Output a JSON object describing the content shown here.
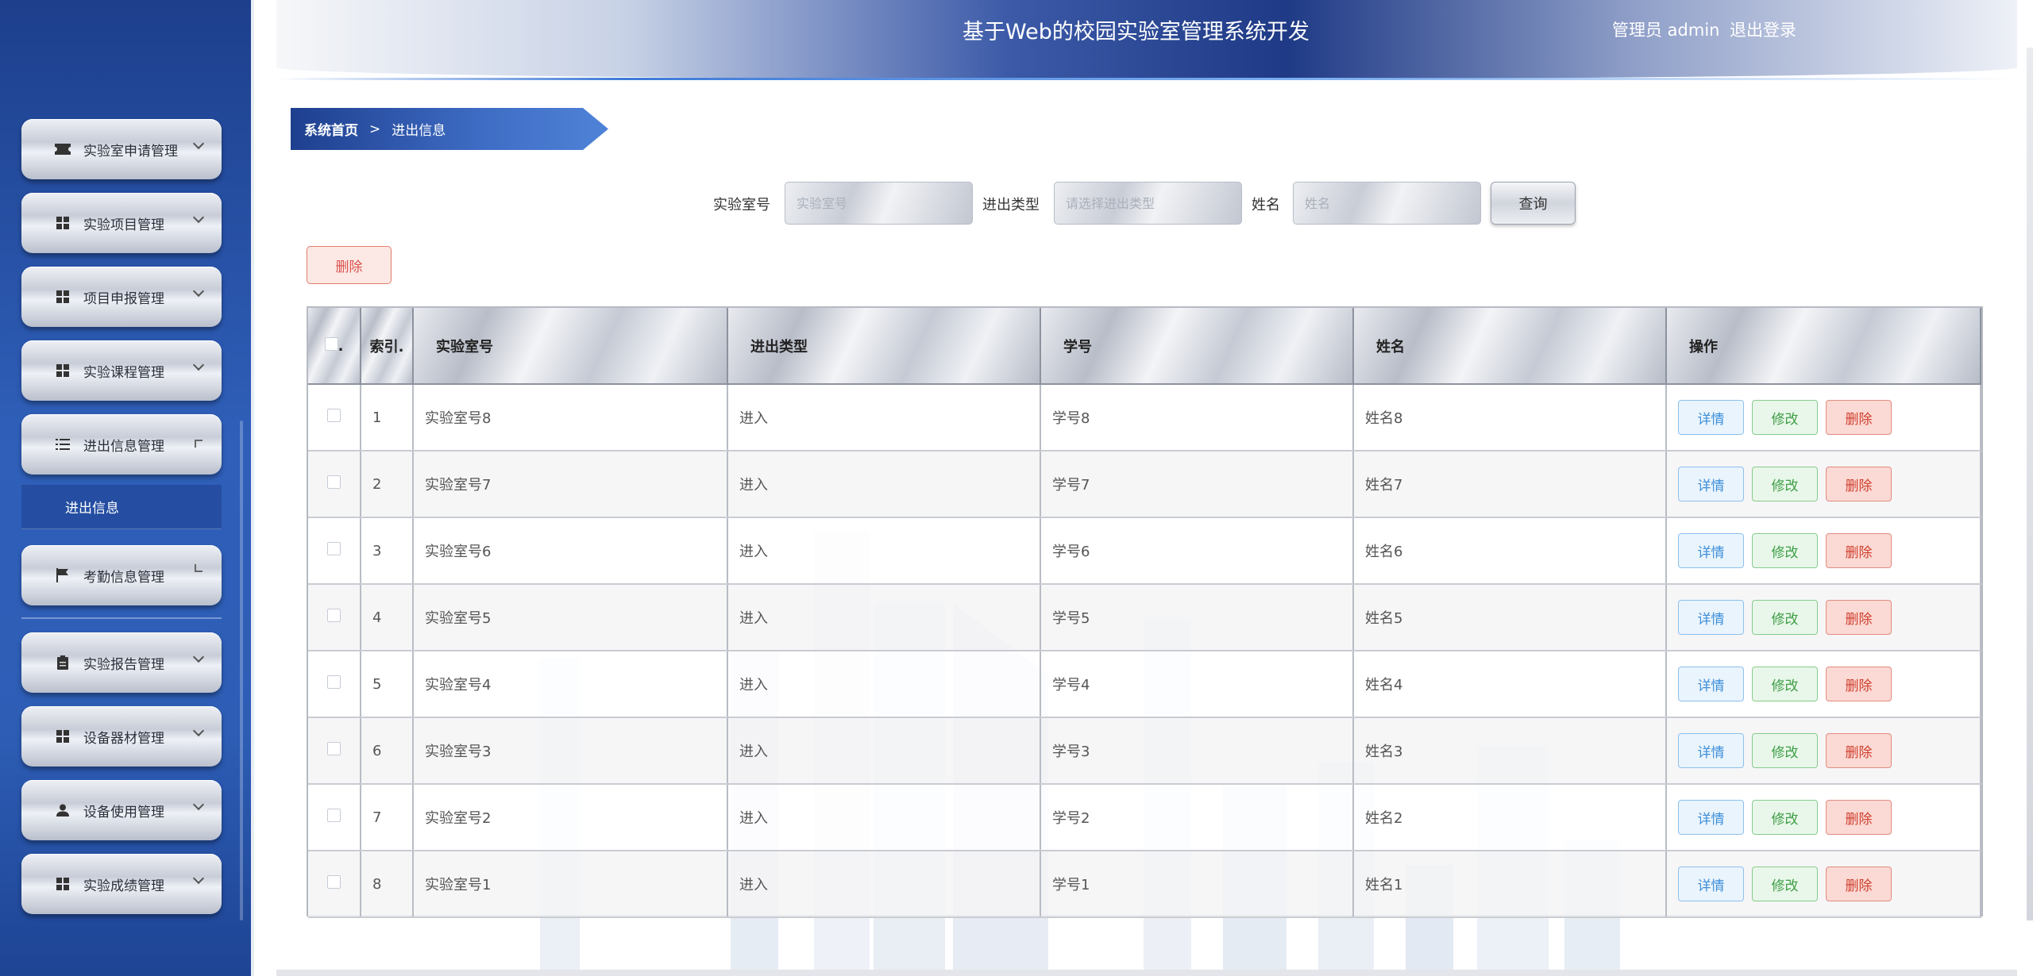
{
  "app": {
    "title": "基于Web的校园实验室管理系统开发"
  },
  "header": {
    "user_label": "管理员 admin",
    "logout_label": "退出登录"
  },
  "sidebar": {
    "items": [
      {
        "label": "实验室申请管理",
        "icon": "ticket-icon"
      },
      {
        "label": "实验项目管理",
        "icon": "grid-icon"
      },
      {
        "label": "项目申报管理",
        "icon": "grid-icon"
      },
      {
        "label": "实验课程管理",
        "icon": "grid-icon"
      },
      {
        "label": "进出信息管理",
        "icon": "list-icon",
        "expanded": true,
        "sub": "进出信息"
      },
      {
        "label": "考勤信息管理",
        "icon": "flag-icon"
      },
      {
        "label": "实验报告管理",
        "icon": "clipboard-icon"
      },
      {
        "label": "设备器材管理",
        "icon": "grid-icon"
      },
      {
        "label": "设备使用管理",
        "icon": "user-icon"
      },
      {
        "label": "实验成绩管理",
        "icon": "grid-icon"
      }
    ]
  },
  "breadcrumb": {
    "home": "系统首页",
    "separator": ">",
    "current": "进出信息"
  },
  "search": {
    "lab_label": "实验室号",
    "lab_placeholder": "实验室号",
    "type_label": "进出类型",
    "type_placeholder": "请选择进出类型",
    "name_label": "姓名",
    "name_placeholder": "姓名",
    "query_button": "查询"
  },
  "toolbar": {
    "delete_label": "删除"
  },
  "table": {
    "columns": {
      "check": ".",
      "index": "索引.",
      "lab": "实验室号",
      "type": "进出类型",
      "student_id": "学号",
      "name": "姓名",
      "actions": "操作"
    },
    "actions": {
      "detail": "详情",
      "edit": "修改",
      "delete": "删除"
    },
    "rows": [
      {
        "index": "1",
        "lab": "实验室号8",
        "type": "进入",
        "student_id": "学号8",
        "name": "姓名8"
      },
      {
        "index": "2",
        "lab": "实验室号7",
        "type": "进入",
        "student_id": "学号7",
        "name": "姓名7"
      },
      {
        "index": "3",
        "lab": "实验室号6",
        "type": "进入",
        "student_id": "学号6",
        "name": "姓名6"
      },
      {
        "index": "4",
        "lab": "实验室号5",
        "type": "进入",
        "student_id": "学号5",
        "name": "姓名5"
      },
      {
        "index": "5",
        "lab": "实验室号4",
        "type": "进入",
        "student_id": "学号4",
        "name": "姓名4"
      },
      {
        "index": "6",
        "lab": "实验室号3",
        "type": "进入",
        "student_id": "学号3",
        "name": "姓名3"
      },
      {
        "index": "7",
        "lab": "实验室号2",
        "type": "进入",
        "student_id": "学号2",
        "name": "姓名2"
      },
      {
        "index": "8",
        "lab": "实验室号1",
        "type": "进入",
        "student_id": "学号1",
        "name": "姓名1"
      }
    ]
  },
  "colors": {
    "sidebar_blue": "#2f5fb9",
    "header_navy": "#1f3a86",
    "detail_blue": "#3d8fd9",
    "edit_green": "#3e9e46",
    "delete_red": "#d0402f"
  }
}
